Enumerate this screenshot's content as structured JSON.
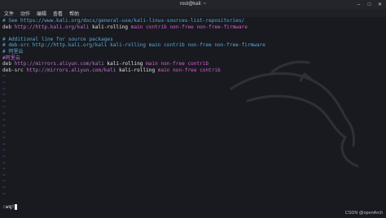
{
  "window": {
    "title": "root@kali: ~",
    "controls": {
      "minimize": "–",
      "maximize": "□",
      "close": "✕"
    }
  },
  "menu": [
    "文件",
    "动作",
    "编辑",
    "查看",
    "帮助"
  ],
  "sources": {
    "line1": {
      "hash": "#",
      "text": " See https://www.kali.org/docs/general-use/kali-linux-sources-list-repositories/"
    },
    "line2": {
      "kw": "deb",
      "url": " http://http.kali.org/kali",
      "suite": " kali-rolling",
      "components": " main contrib non-free non-free-firmware"
    },
    "line4": {
      "text": "# Additional line for source packages"
    },
    "line5": {
      "text": "# deb-src http://http.kali.org/kali kali-rolling main contrib non-free non-free-firmware"
    },
    "line6": {
      "text": "# 阿里云"
    },
    "line7": {
      "text": "#阿里云"
    },
    "line8": {
      "kw": "deb",
      "url": " http://mirrors.aliyun.com/kali",
      "suite": " kali-rolling",
      "components": " main non-free contrib"
    },
    "line9": {
      "kw": "deb-src",
      "url": " http://mirrors.aliyun.com/kali",
      "suite": " kali-rolling",
      "components": " main non-free contrib"
    }
  },
  "tilde": "~",
  "command": ":wq!",
  "watermark": "CSDN @openArch",
  "colors": {
    "background": "#181a1f",
    "comment": "#5aa9d6",
    "url": "#c46fd6",
    "components": "#d95fd0",
    "tilde": "#4a6fb5"
  }
}
